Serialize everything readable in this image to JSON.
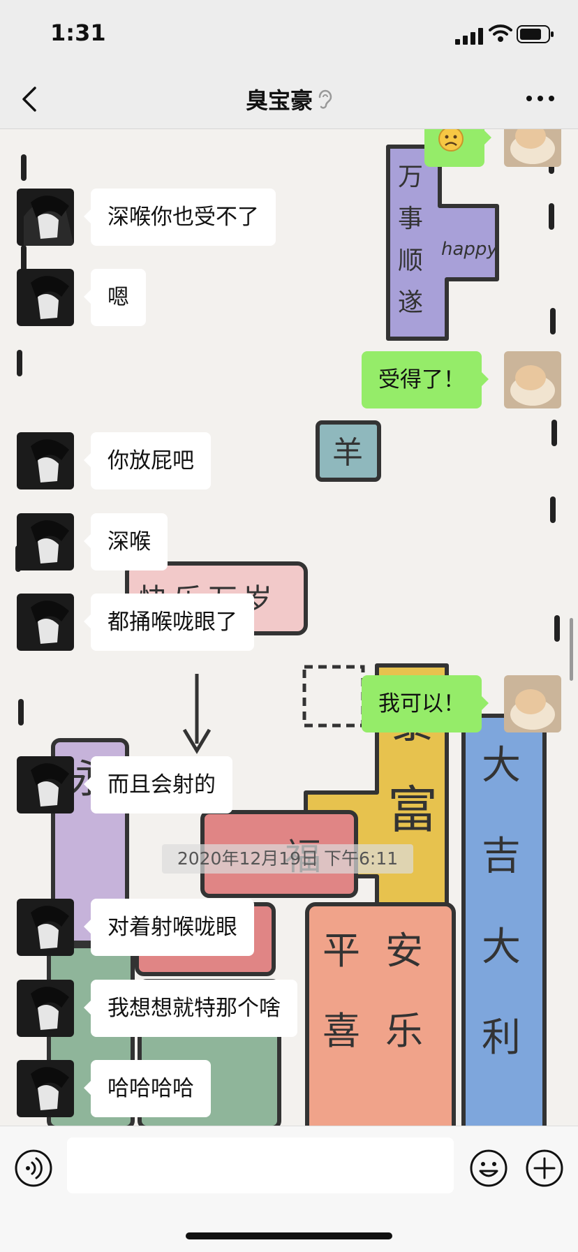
{
  "status_bar": {
    "time": "1:31"
  },
  "header": {
    "title": "臭宝豪"
  },
  "messages": {
    "m1": "深喉你也受不了",
    "m2": "嗯",
    "m3": "受得了！",
    "m4": "你放屁吧",
    "m5": "深喉",
    "m6": "都捅喉咙眼了",
    "m7": "我可以！",
    "m8": "而且会射的",
    "m9": "对着射喉咙眼",
    "m10": "我想想就特那个啥",
    "m11": "哈哈哈哈"
  },
  "timestamp": "2020年12月19日 下午6:11",
  "wallpaper_text": {
    "w1": "万事顺遂",
    "w2": "happy",
    "w3": "羊",
    "w4": "快乐万岁",
    "w5": "暴富",
    "w6": "大吉大利",
    "w7": "平安喜乐",
    "w8": "幸福",
    "w9": "永远"
  },
  "colors": {
    "self_bubble": "#95ec69",
    "other_bubble": "#ffffff",
    "background": "#ededed"
  },
  "icons": [
    "back-icon",
    "ear-icon",
    "more-icon",
    "voice-icon",
    "emoji-icon",
    "plus-icon"
  ]
}
